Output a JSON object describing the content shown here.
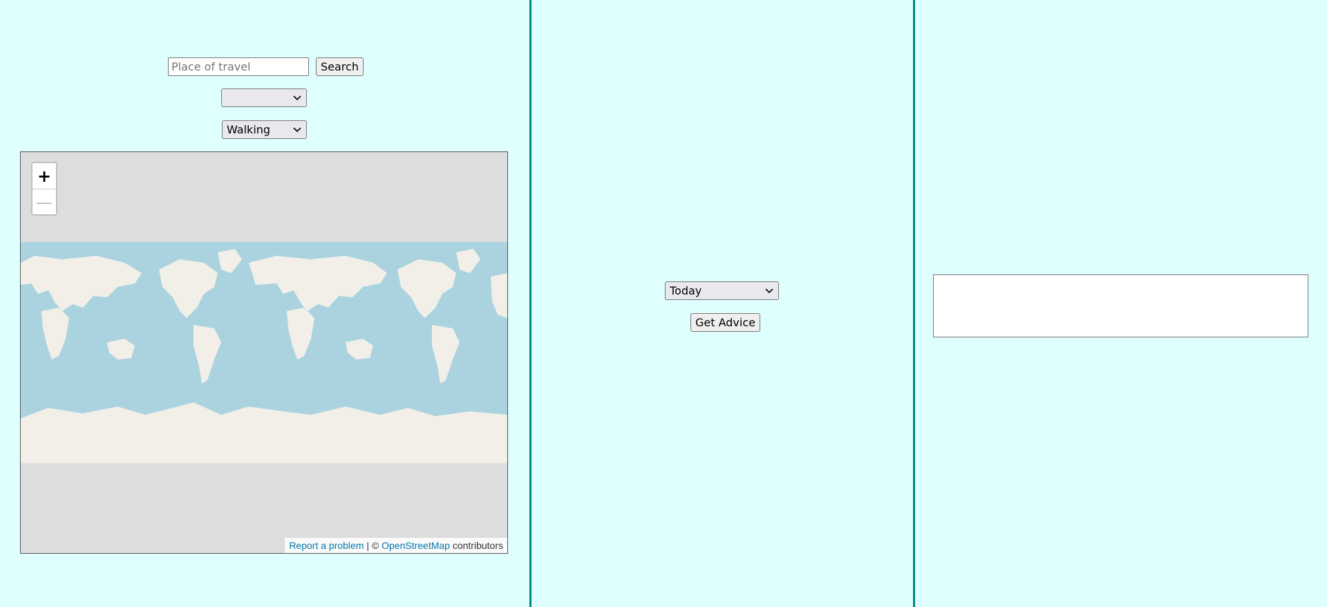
{
  "search": {
    "placeholder": "Place of travel",
    "button_label": "Search"
  },
  "location_select": {
    "selected": ""
  },
  "mode_select": {
    "selected": "Walking"
  },
  "map": {
    "zoom_in_label": "+",
    "zoom_out_label": "—",
    "attribution": {
      "report_link": "Report a problem",
      "separator": " | © ",
      "osm_link": "OpenStreetMap",
      "suffix": " contributors"
    },
    "colors": {
      "ocean": "#aad3df",
      "land": "#f2efe9",
      "background": "#dddddd"
    }
  },
  "when_select": {
    "selected": "Today"
  },
  "advice": {
    "button_label": "Get Advice",
    "output": ""
  },
  "theme": {
    "background": "#dfffff",
    "divider": "#008b80"
  }
}
